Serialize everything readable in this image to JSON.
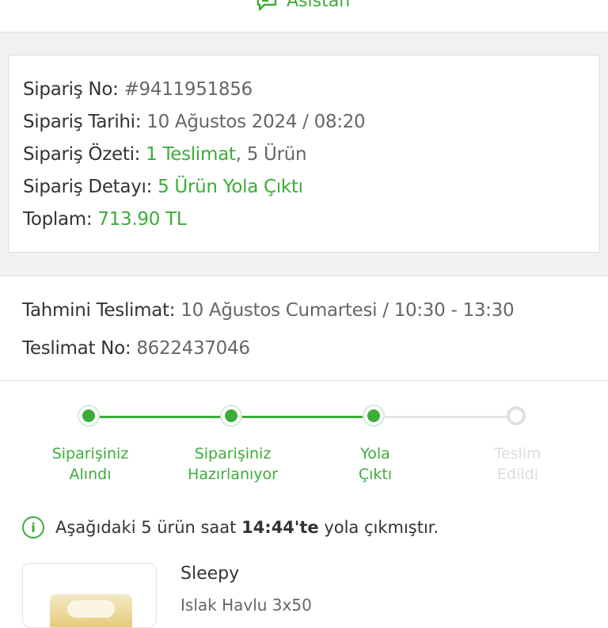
{
  "header": {
    "assistant_label": "Asistan",
    "assistant_icon": "chat-bubble-icon"
  },
  "order": {
    "order_no_label": "Sipariş No:",
    "order_no_value": "#9411951856",
    "order_date_label": "Sipariş Tarihi:",
    "order_date_value": "10 Ağustos 2024 / 08:20",
    "summary_label": "Sipariş Özeti:",
    "summary_deliveries": "1 Teslimat",
    "summary_separator": ",",
    "summary_products": "5 Ürün",
    "detail_label": "Sipariş Detayı:",
    "detail_value": "5 Ürün Yola Çıktı",
    "total_label": "Toplam:",
    "total_value": "713.90 TL"
  },
  "delivery": {
    "estimate_label": "Tahmini Teslimat:",
    "estimate_value": "10 Ağustos Cumartesi / 10:30 - 13:30",
    "delivery_no_label": "Teslimat No:",
    "delivery_no_value": "8622437046"
  },
  "progress": {
    "steps": [
      {
        "line1": "Siparişiniz",
        "line2": "Alındı",
        "state": "done"
      },
      {
        "line1": "Siparişiniz",
        "line2": "Hazırlanıyor",
        "state": "done"
      },
      {
        "line1": "Yola",
        "line2": "Çıktı",
        "state": "done"
      },
      {
        "line1": "Teslim",
        "line2": "Edildi",
        "state": "pending"
      }
    ],
    "completed_steps": 3,
    "total_steps": 4
  },
  "notice": {
    "icon": "info-icon",
    "icon_glyph": "i",
    "text_before": "Aşağıdaki 5 ürün saat ",
    "time": "14:44'te",
    "text_after": " yola çıkmıştır."
  },
  "product": {
    "brand": "Sleepy",
    "name": "Islak Havlu 3x50"
  },
  "colors": {
    "accent": "#3cac3a",
    "inactive": "#dcdcdc",
    "background_gap": "#f1f1f1"
  }
}
